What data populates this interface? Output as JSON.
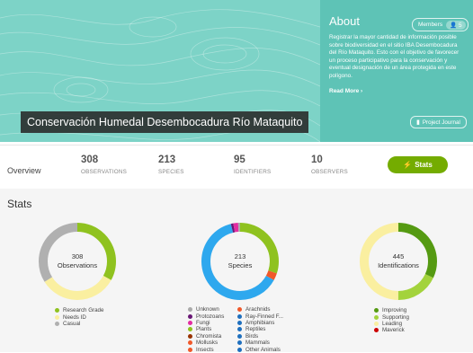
{
  "project": {
    "title": "Conservación Humedal Desembocadura Río Mataquito"
  },
  "about": {
    "heading": "About",
    "members_label": "Members",
    "members_count": "5",
    "description": "Registrar la mayor cantidad de información posible sobre biodiversidad en el sitio IBA Desembocadura del Río Mataquito. Esto con el objetivo de favorecer un proceso participativo para la conservación y eventual designación de un área protegida en este polígono.",
    "read_more": "Read More ›",
    "journal_label": "Project Journal"
  },
  "overview": {
    "label": "Overview",
    "stats": [
      {
        "value": "308",
        "label": "OBSERVATIONS"
      },
      {
        "value": "213",
        "label": "SPECIES"
      },
      {
        "value": "95",
        "label": "IDENTIFIERS"
      },
      {
        "value": "10",
        "label": "OBSERVERS"
      }
    ],
    "stats_button": "Stats"
  },
  "stats_section": {
    "heading": "Stats"
  },
  "chart_data": [
    {
      "type": "pie",
      "center_value": "308",
      "center_label": "Observations",
      "slices": [
        {
          "label": "Research Grade",
          "value": 0.33,
          "color": "#8fc21f"
        },
        {
          "label": "Needs ID",
          "value": 0.33,
          "color": "#faefa0"
        },
        {
          "label": "Casual",
          "value": 0.34,
          "color": "#b0b0b0"
        }
      ]
    },
    {
      "type": "pie",
      "center_value": "213",
      "center_label": "Species",
      "slices": [
        {
          "label": "Plants",
          "value": 0.3,
          "color": "#8fc21f"
        },
        {
          "label": "Mollusks",
          "value": 0.03,
          "color": "#f0582a"
        },
        {
          "label": "Birds",
          "value": 0.63,
          "color": "#2ea8ee"
        },
        {
          "label": "Protozoans",
          "value": 0.01,
          "color": "#691776"
        },
        {
          "label": "Fungi",
          "value": 0.02,
          "color": "#e32ca1"
        },
        {
          "label": "Unknown",
          "value": 0.01,
          "color": "#aaaaaa"
        }
      ],
      "legend": [
        {
          "label": "Unknown",
          "color": "#aaaaaa"
        },
        {
          "label": "Protozoans",
          "color": "#691776"
        },
        {
          "label": "Fungi",
          "color": "#e32ca1"
        },
        {
          "label": "Plants",
          "color": "#8fc21f"
        },
        {
          "label": "Chromista",
          "color": "#993300"
        },
        {
          "label": "Mollusks",
          "color": "#f0582a"
        },
        {
          "label": "Insects",
          "color": "#f0582a"
        },
        {
          "label": "Arachnids",
          "color": "#f0582a"
        },
        {
          "label": "Ray-Finned F...",
          "color": "#1e6fbe"
        },
        {
          "label": "Amphibians",
          "color": "#1e6fbe"
        },
        {
          "label": "Reptiles",
          "color": "#1e6fbe"
        },
        {
          "label": "Birds",
          "color": "#1e6fbe"
        },
        {
          "label": "Mammals",
          "color": "#1e6fbe"
        },
        {
          "label": "Other Animals",
          "color": "#1e6fbe"
        }
      ]
    },
    {
      "type": "pie",
      "center_value": "445",
      "center_label": "Identifications",
      "slices": [
        {
          "label": "Improving",
          "value": 0.32,
          "color": "#559a12"
        },
        {
          "label": "Supporting",
          "value": 0.18,
          "color": "#a3d33c"
        },
        {
          "label": "Leading",
          "value": 0.5,
          "color": "#faefa0"
        },
        {
          "label": "Maverick",
          "value": 0.0,
          "color": "#cc0000"
        }
      ]
    }
  ],
  "colors": {
    "accent": "#74ac00",
    "hero_bg": "#7dd3c7",
    "about_bg": "#5ec3b6"
  }
}
